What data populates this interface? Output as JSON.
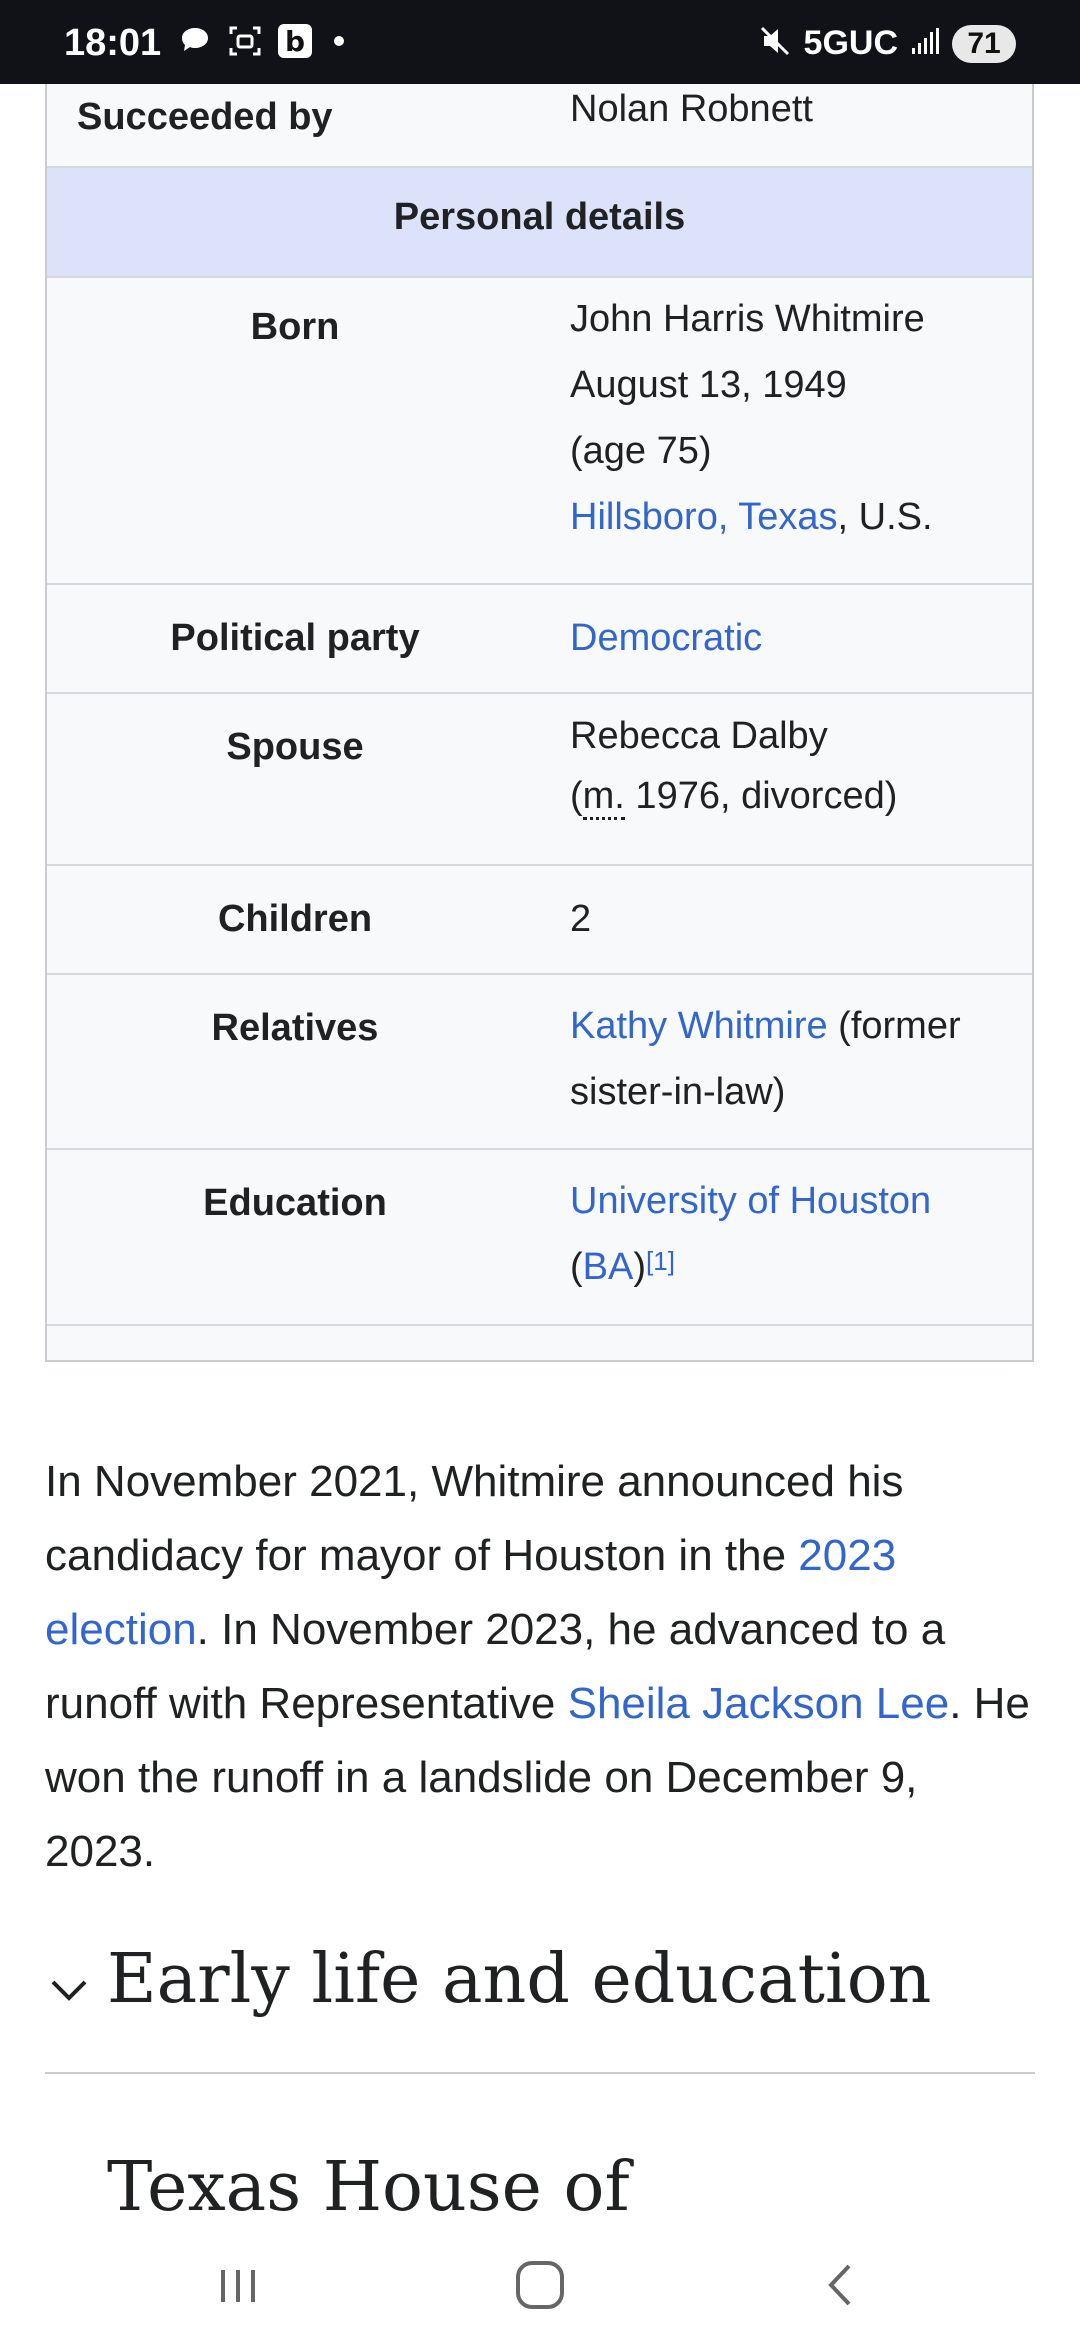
{
  "status_bar": {
    "time": "18:01",
    "icons_left": [
      "chat-bubble-icon",
      "screenshot-icon",
      "b-app-icon",
      "dot-icon"
    ],
    "b_letter": "b",
    "network": "5GUC",
    "battery": "71",
    "icons_right": [
      "mute-icon",
      "signal-icon"
    ]
  },
  "infobox": {
    "succeeded_by": {
      "label": "Succeeded by",
      "value": "Nolan Robnett"
    },
    "section_header": "Personal details",
    "born": {
      "label": "Born",
      "name": "John Harris Whitmire",
      "date": "August 13, 1949",
      "age": "(age 75)",
      "place_link": "Hillsboro, Texas",
      "place_suffix": ", U.S."
    },
    "party": {
      "label": "Political party",
      "value": "Democratic"
    },
    "spouse": {
      "label": "Spouse",
      "name": "Rebecca Dalby",
      "open_paren": "(",
      "abbr": "m.",
      "detail": " 1976, divorced)"
    },
    "children": {
      "label": "Children",
      "value": "2"
    },
    "relatives": {
      "label": "Relatives",
      "link": "Kathy Whitmire",
      "suffix_line1": " (former",
      "line2": "sister-in-law)"
    },
    "education": {
      "label": "Education",
      "link": "University of Houston",
      "open_paren": "(",
      "degree_link": "BA",
      "close_paren": ")",
      "ref": "[1]"
    }
  },
  "paragraph": {
    "t1": "In November 2021, Whitmire announced his candidacy for mayor of Houston in the ",
    "link1": "2023 election",
    "t2": ". In November 2023, he advanced to a runoff with Representative ",
    "link2": "Sheila Jackson Lee",
    "t3": ". He won the runoff in a landslide on December 9, 2023."
  },
  "sections": {
    "early_life": "Early life and education",
    "texas_house": "Texas House of"
  },
  "nav": {
    "recents": "recents-icon",
    "home": "home-icon",
    "back": "back-icon"
  },
  "colors": {
    "link": "#3366cc",
    "header_bg": "#dde2fb",
    "infobox_bg": "#f8f9fa",
    "status_bar": "#111217"
  }
}
